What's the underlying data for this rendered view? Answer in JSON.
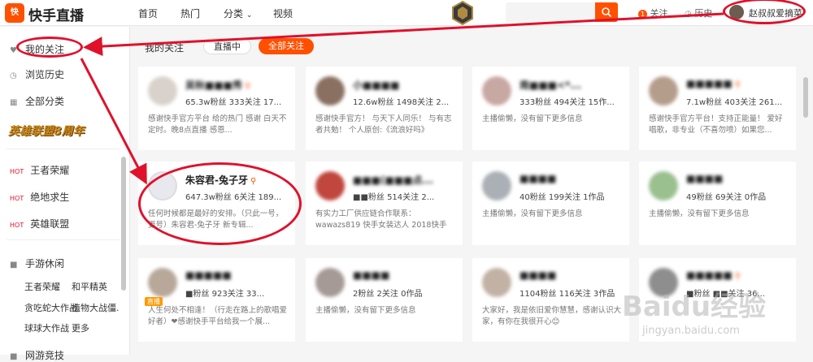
{
  "header": {
    "logo_icon": "快",
    "logo": "快手直播",
    "nav": [
      "首页",
      "热门",
      "分类",
      "视频"
    ],
    "nav_dropdown_mark": "⌄",
    "search_placeholder": "",
    "follow_count": "1",
    "follow_label": "关注",
    "history_label": "历史",
    "user_name": "赵叔叔爱摘菜"
  },
  "sidebar": {
    "primary": [
      {
        "label": "我的关注",
        "icon": "heart-icon"
      },
      {
        "label": "浏览历史",
        "icon": "clock-icon"
      },
      {
        "label": "全部分类",
        "icon": "grid-icon"
      }
    ],
    "banner": "英雄联盟8周年",
    "hot_tag": "HOT",
    "hot_games": [
      "王者荣耀",
      "绝地求生",
      "英雄联盟"
    ],
    "section_title": "手游休闲",
    "sub_items": [
      "王者荣耀",
      "和平精英",
      "贪吃蛇大作战",
      "植物大战僵...",
      "球球大作战",
      "更多"
    ],
    "section2_title": "网游竞技"
  },
  "main": {
    "title": "我的关注",
    "tabs": [
      "直播中",
      "全部关注"
    ],
    "live_tag": "直播",
    "cards": [
      {
        "name": "吴秋■■■秀",
        "stats": "65.3w粉丝  333关注  17...",
        "desc": "感谢快手官方平台 给的热门 感谢 白天不定时。晚8点直播 感恩..."
      },
      {
        "name": "小■■■■",
        "stats": "12.6w粉丝  1498关注  2...",
        "desc": "感谢快手官方！ 与天下人同乐！ 与有志者共勉！ 个人原创:《流浪好吗》"
      },
      {
        "name": "南■■■<*...",
        "stats": "333粉丝  494关注  15作...",
        "desc": "主播偷懒，没有留下更多信息"
      },
      {
        "name": "■■■■■",
        "stats": "7.1w粉丝  403关注  261...",
        "desc": "感谢快手官方平台！支持正能量！ 爱好唱歌，非专业（不喜勿喷）如果您..."
      },
      {
        "name": "朱容君-兔子牙",
        "stats": "647.3w粉丝  6关注  189...",
        "desc": "任何时候都是最好的安排。（只此一号，更号）朱容君-兔子牙 新专辑..."
      },
      {
        "name": "■■■(■■■点...",
        "stats": "■■粉丝  514关注  2...",
        "desc": "有实力工厂供应链合作联系：wawazs819 快手女装达人 2018快手卖..."
      },
      {
        "name": "■■■■",
        "stats": "40粉丝  199关注  1作品",
        "desc": "主播偷懒，没有留下更多信息"
      },
      {
        "name": "■■■■",
        "stats": "49粉丝  69关注  0作品",
        "desc": "主播偷懒，没有留下更多信息"
      },
      {
        "name": "■■■■■",
        "stats": "■粉丝  923关注  33...",
        "desc": "人生何处不相逢！（行走在路上的歌唱爱好者）❤感谢快手平台给我一个展..."
      },
      {
        "name": "■■■■",
        "stats": "2粉丝  2关注  0作品",
        "desc": "主播偷懒，没有留下更多信息"
      },
      {
        "name": "■■■■",
        "stats": "1104粉丝  116关注  3作品",
        "desc": "大家好，我是依旧爱你慧慧，感谢认识大家，有你在我很开心😊"
      },
      {
        "name": "■■■■■",
        "stats": "■粉丝  ■■关注  36...",
        "desc": ""
      }
    ]
  },
  "watermark": {
    "text": "Baidu经验",
    "sub": "jingyan.baidu.com"
  },
  "colors": {
    "accent": "#ff5000",
    "annotation": "#e0112b"
  }
}
